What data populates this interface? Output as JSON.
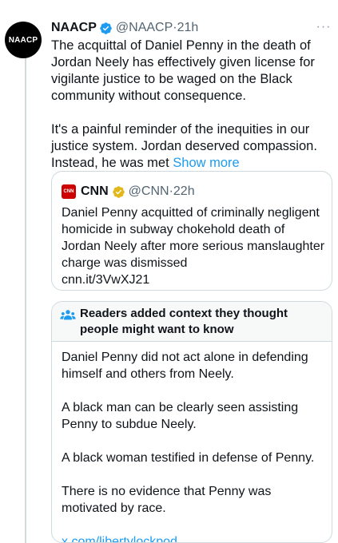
{
  "tweet": {
    "avatar_text": "NAACP",
    "name": "NAACP",
    "handle": "@NAACP",
    "dot": "·",
    "time": "21h",
    "paragraph_1": "The acquittal of Daniel Penny in the death of Jordan Neely has effectively given license for vigilante justice to be waged on the Black community without consequence.",
    "paragraph_2": "It's a painful reminder of the inequities in our justice system. Jordan deserved compassion. Instead, he was met",
    "show_more": "Show more",
    "more_icon": "···"
  },
  "quote": {
    "logo_text": "CNN",
    "name": "CNN",
    "handle": "@CNN",
    "dot": "·",
    "time": "22h",
    "text": "Daniel Penny acquitted of criminally negligent homicide in subway chokehold death of Jordan Neely after more serious manslaughter charge was dismissed",
    "link": "cnn.it/3VwXJ21"
  },
  "community_note": {
    "title": "Readers added context they thought people might want to know",
    "paragraphs": [
      "Daniel Penny did not act alone in defending himself and others from Neely.",
      "A black man can be clearly seen assisting Penny to subdue Neely.",
      "A black woman testified in defense of Penny.",
      "There is no evidence that Penny was motivated by race."
    ],
    "link": "x.com/libertylockpod..."
  },
  "colors": {
    "accent": "#1d9bf0",
    "verified_blue": "#1d9bf0",
    "verified_gold": "#e2b719",
    "secondary_text": "#536471",
    "border": "#cfd9de"
  }
}
